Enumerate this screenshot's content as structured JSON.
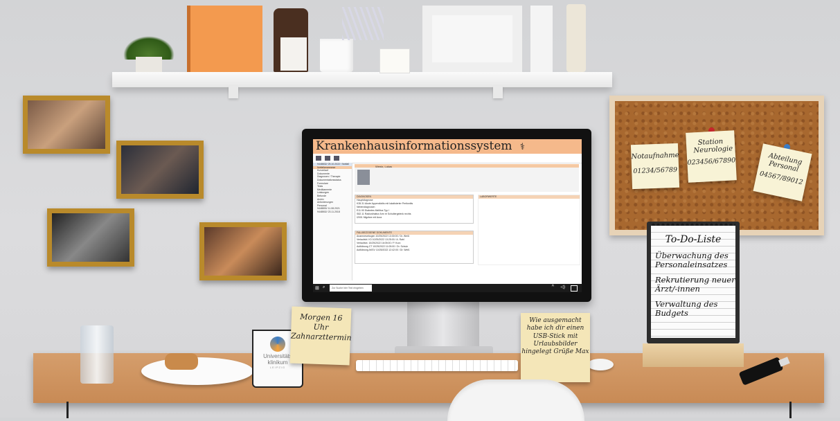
{
  "his": {
    "title": "Krankenhausinformationssystem",
    "patient_name": "Wentz, Lukas",
    "sidebar": [
      "9448832/ 25.10.2022 / Notfall",
      "Notfallanamnese",
      "Kurverlauf",
      "Dokumente",
      "Diagnosen / Therapie",
      "Dokumentationsstatus",
      "Formulare",
      "Tests",
      "Medikamente",
      "Leistungen",
      "Befunde",
      "Archiv",
      "Anforderungen",
      "Personal",
      "9448830/ 11.08.2021",
      "9448502/ 23.11.2018"
    ],
    "diagnosis_title": "DIAGNOSEN",
    "diagnoses": [
      "Hauptdiagnose",
      "K35.31   Akute Appendizitis mit lokalisierter Peritonitis",
      "Nebendiagnosen",
      "E11.90   Diabetes Mellitus Typ I",
      "S82.11   Radiusfraktur Arm re Schultergelenk rechts",
      "I2001    Migräne mit Aura"
    ],
    "docs_title": "FALLBEZOGENE DOKUMENTE",
    "docs": [
      "Anamnesebogen   10/25/2022 13:30:00 / Dr. Weiß",
      "Verlaufsbl. K3  10/25/2022 13:25:00 / A. Rahl",
      "Verlaufsbl.     10/25/2022 16:05:00 / P. Kurz",
      "Aufklärung CT   10/25/2022 11:05:00 / Dr. Schulz",
      "Aufklärung AKSV 10/25/2022 12:42:00 / Dr. Weiß"
    ],
    "findings_title": "LABORWERTE",
    "search_placeholder": "Zur Suche hier Text eingeben"
  },
  "corkboard": {
    "notes": [
      {
        "title": "Notaufnahme",
        "number": "01234/56789"
      },
      {
        "title": "Station Neurologie",
        "number": "023456/67890"
      },
      {
        "title": "Abteilung Personal",
        "number": "04567/89012"
      }
    ]
  },
  "sticky_left": "Morgen 16 Uhr Zahnarzttermin",
  "sticky_right": "Wie ausgemacht habe ich dir einen USB-Stick mit Urlaubsbilder hingelegt Grüße Max",
  "todo": {
    "title": "To-Do-Liste",
    "items": [
      "Überwachung des Personaleinsatzes",
      "Rekrutierung neuer Ärzt/-innen",
      "Verwaltung des Budgets"
    ]
  },
  "mug": {
    "line1": "Universitäts",
    "line2": "klinikum",
    "line3": "LEIPZIG"
  },
  "colors": {
    "accent": "#f5b98b",
    "desk": "#d09460",
    "frame": "#b98a2b",
    "cork": "#a8682f"
  }
}
